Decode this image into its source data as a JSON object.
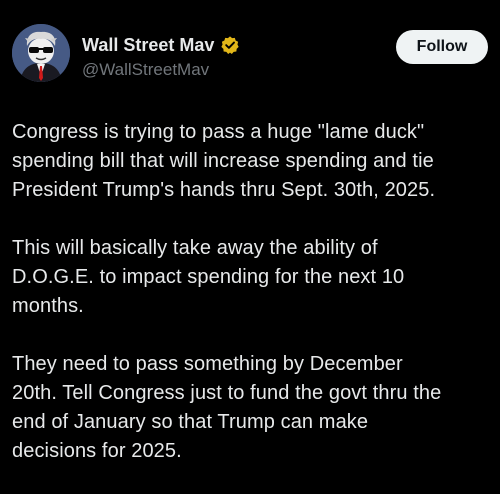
{
  "author": {
    "display_name": "Wall Street Mav",
    "handle": "@WallStreetMav",
    "verified": true,
    "verified_badge_color": "#e2b719",
    "avatar_icon": "avatar-wallstreet-character-icon"
  },
  "actions": {
    "follow_label": "Follow"
  },
  "tweet": {
    "paragraphs": [
      {
        "lines": [
          "Congress is trying to pass a huge \"lame duck\"",
          "spending bill that will increase spending and tie",
          "President Trump's hands thru Sept. 30th, 2025."
        ]
      },
      {
        "lines": [
          "This will basically take away the ability of",
          "D.O.G.E. to impact spending for the next 10",
          "months."
        ]
      },
      {
        "lines": [
          "They need to pass something by December",
          "20th. Tell Congress just to fund the govt thru the",
          "end of January so that Trump can make",
          "decisions for 2025."
        ]
      }
    ]
  },
  "colors": {
    "background": "#000000",
    "text_primary": "#e7e9ea",
    "text_secondary": "#71767b",
    "follow_bg": "#eff3f4"
  }
}
